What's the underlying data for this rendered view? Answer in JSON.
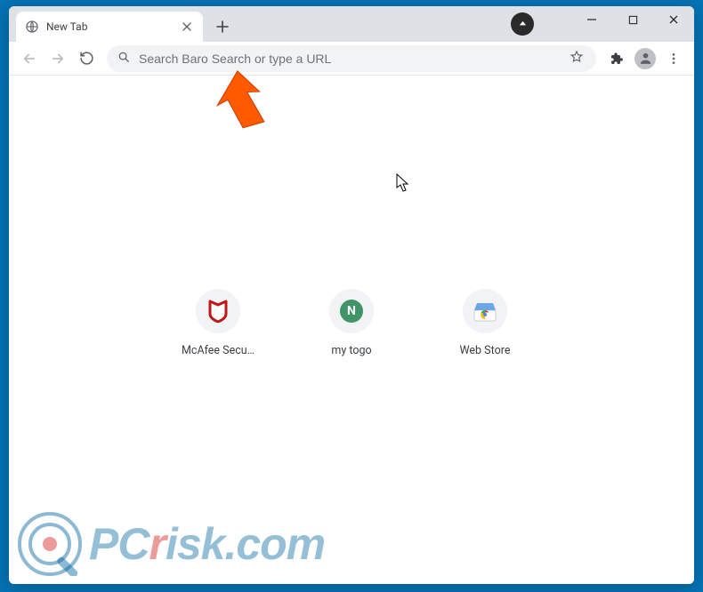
{
  "tab": {
    "title": "New Tab"
  },
  "omnibox": {
    "placeholder": "Search Baro Search or type a URL"
  },
  "shortcuts": [
    {
      "label": "McAfee Secu…",
      "icon": "mcafee"
    },
    {
      "label": "my togo",
      "icon": "n-badge",
      "letter": "N"
    },
    {
      "label": "Web Store",
      "icon": "webstore"
    }
  ],
  "watermark": {
    "text_left": "PC",
    "text_r": "r",
    "text_right": "isk.com"
  },
  "colors": {
    "accent": "#0573b5",
    "chrome_bg": "#dee1e6",
    "omnibox_bg": "#f1f3f4",
    "arrow": "#ff5a00"
  }
}
